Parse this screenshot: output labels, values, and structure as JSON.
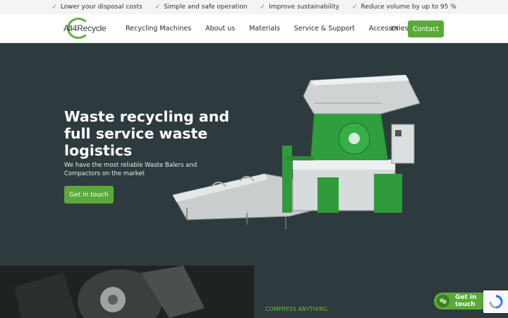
{
  "usp_bar": {
    "items": [
      "Lower your disposal costs",
      "Simple and safe operation",
      "Improve sustainability",
      "Reduce volume by up to 95 %"
    ]
  },
  "header": {
    "logo_text": "All4Recycle",
    "nav": [
      "Recycling Machines",
      "About us",
      "Materials",
      "Service & Support",
      "Accessories"
    ],
    "language": "EN",
    "contact_label": "Contact"
  },
  "hero": {
    "title": "Waste recycling and full service waste logistics",
    "subtitle": "We have the most reliable Waste Balers and Compactors on the market",
    "cta_label": "Get in touch"
  },
  "section": {
    "eyebrow": "COMPRESS ANYTHING"
  },
  "floating": {
    "label": "Get in touch"
  },
  "colors": {
    "accent": "#5aaa3a",
    "hero_bg": "#2e3b3e"
  }
}
